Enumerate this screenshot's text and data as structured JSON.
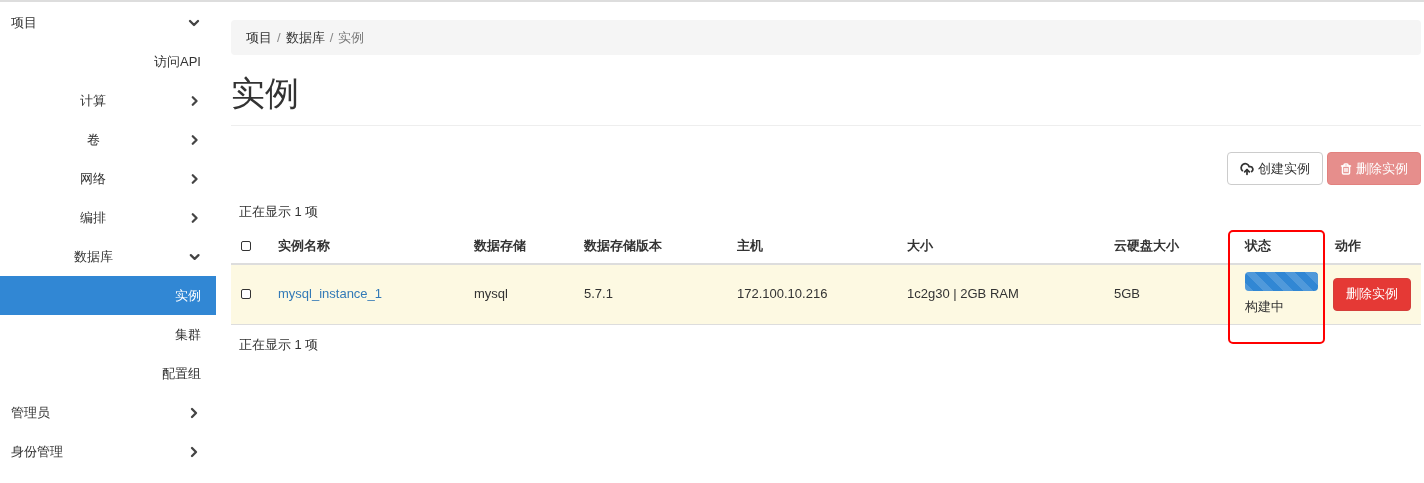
{
  "sidebar": {
    "items": [
      {
        "label": "项目",
        "expanded": true,
        "children": [
          {
            "label": "访问API"
          },
          {
            "label": "计算",
            "expanded": false
          },
          {
            "label": "卷",
            "expanded": false
          },
          {
            "label": "网络",
            "expanded": false
          },
          {
            "label": "编排",
            "expanded": false
          },
          {
            "label": "数据库",
            "expanded": true,
            "children": [
              {
                "label": "实例",
                "selected": true
              },
              {
                "label": "集群",
                "selected": false
              },
              {
                "label": "配置组",
                "selected": false
              }
            ]
          }
        ]
      },
      {
        "label": "管理员",
        "expanded": false
      },
      {
        "label": "身份管理",
        "expanded": false
      }
    ]
  },
  "breadcrumb": {
    "items": [
      "项目",
      "数据库",
      "实例"
    ],
    "separator": "/"
  },
  "page_title": "实例",
  "actions": [
    {
      "label": "创建实例",
      "kind": "create",
      "disabled": false
    },
    {
      "label": "删除实例",
      "kind": "delete",
      "disabled": true
    }
  ],
  "table": {
    "count_top": "正在显示 1 项",
    "count_bottom": "正在显示 1 项",
    "select_all_checked": false,
    "columns": [
      {
        "label": "实例名称",
        "highlighted": false
      },
      {
        "label": "数据存储",
        "highlighted": false
      },
      {
        "label": "数据存储版本",
        "highlighted": false
      },
      {
        "label": "主机",
        "highlighted": false
      },
      {
        "label": "大小",
        "highlighted": false
      },
      {
        "label": "云硬盘大小",
        "highlighted": false
      },
      {
        "label": "状态",
        "highlighted": true
      },
      {
        "label": "动作",
        "highlighted": false
      }
    ],
    "rows": [
      {
        "checked": false,
        "name": "mysql_instance_1",
        "datastore": "mysql",
        "version": "5.7.1",
        "host": "172.100.10.216",
        "size": "1c2g30 | 2GB RAM",
        "volume": "5GB",
        "status": {
          "label": "构建中",
          "level": 1
        },
        "action": "删除实例"
      }
    ]
  }
}
